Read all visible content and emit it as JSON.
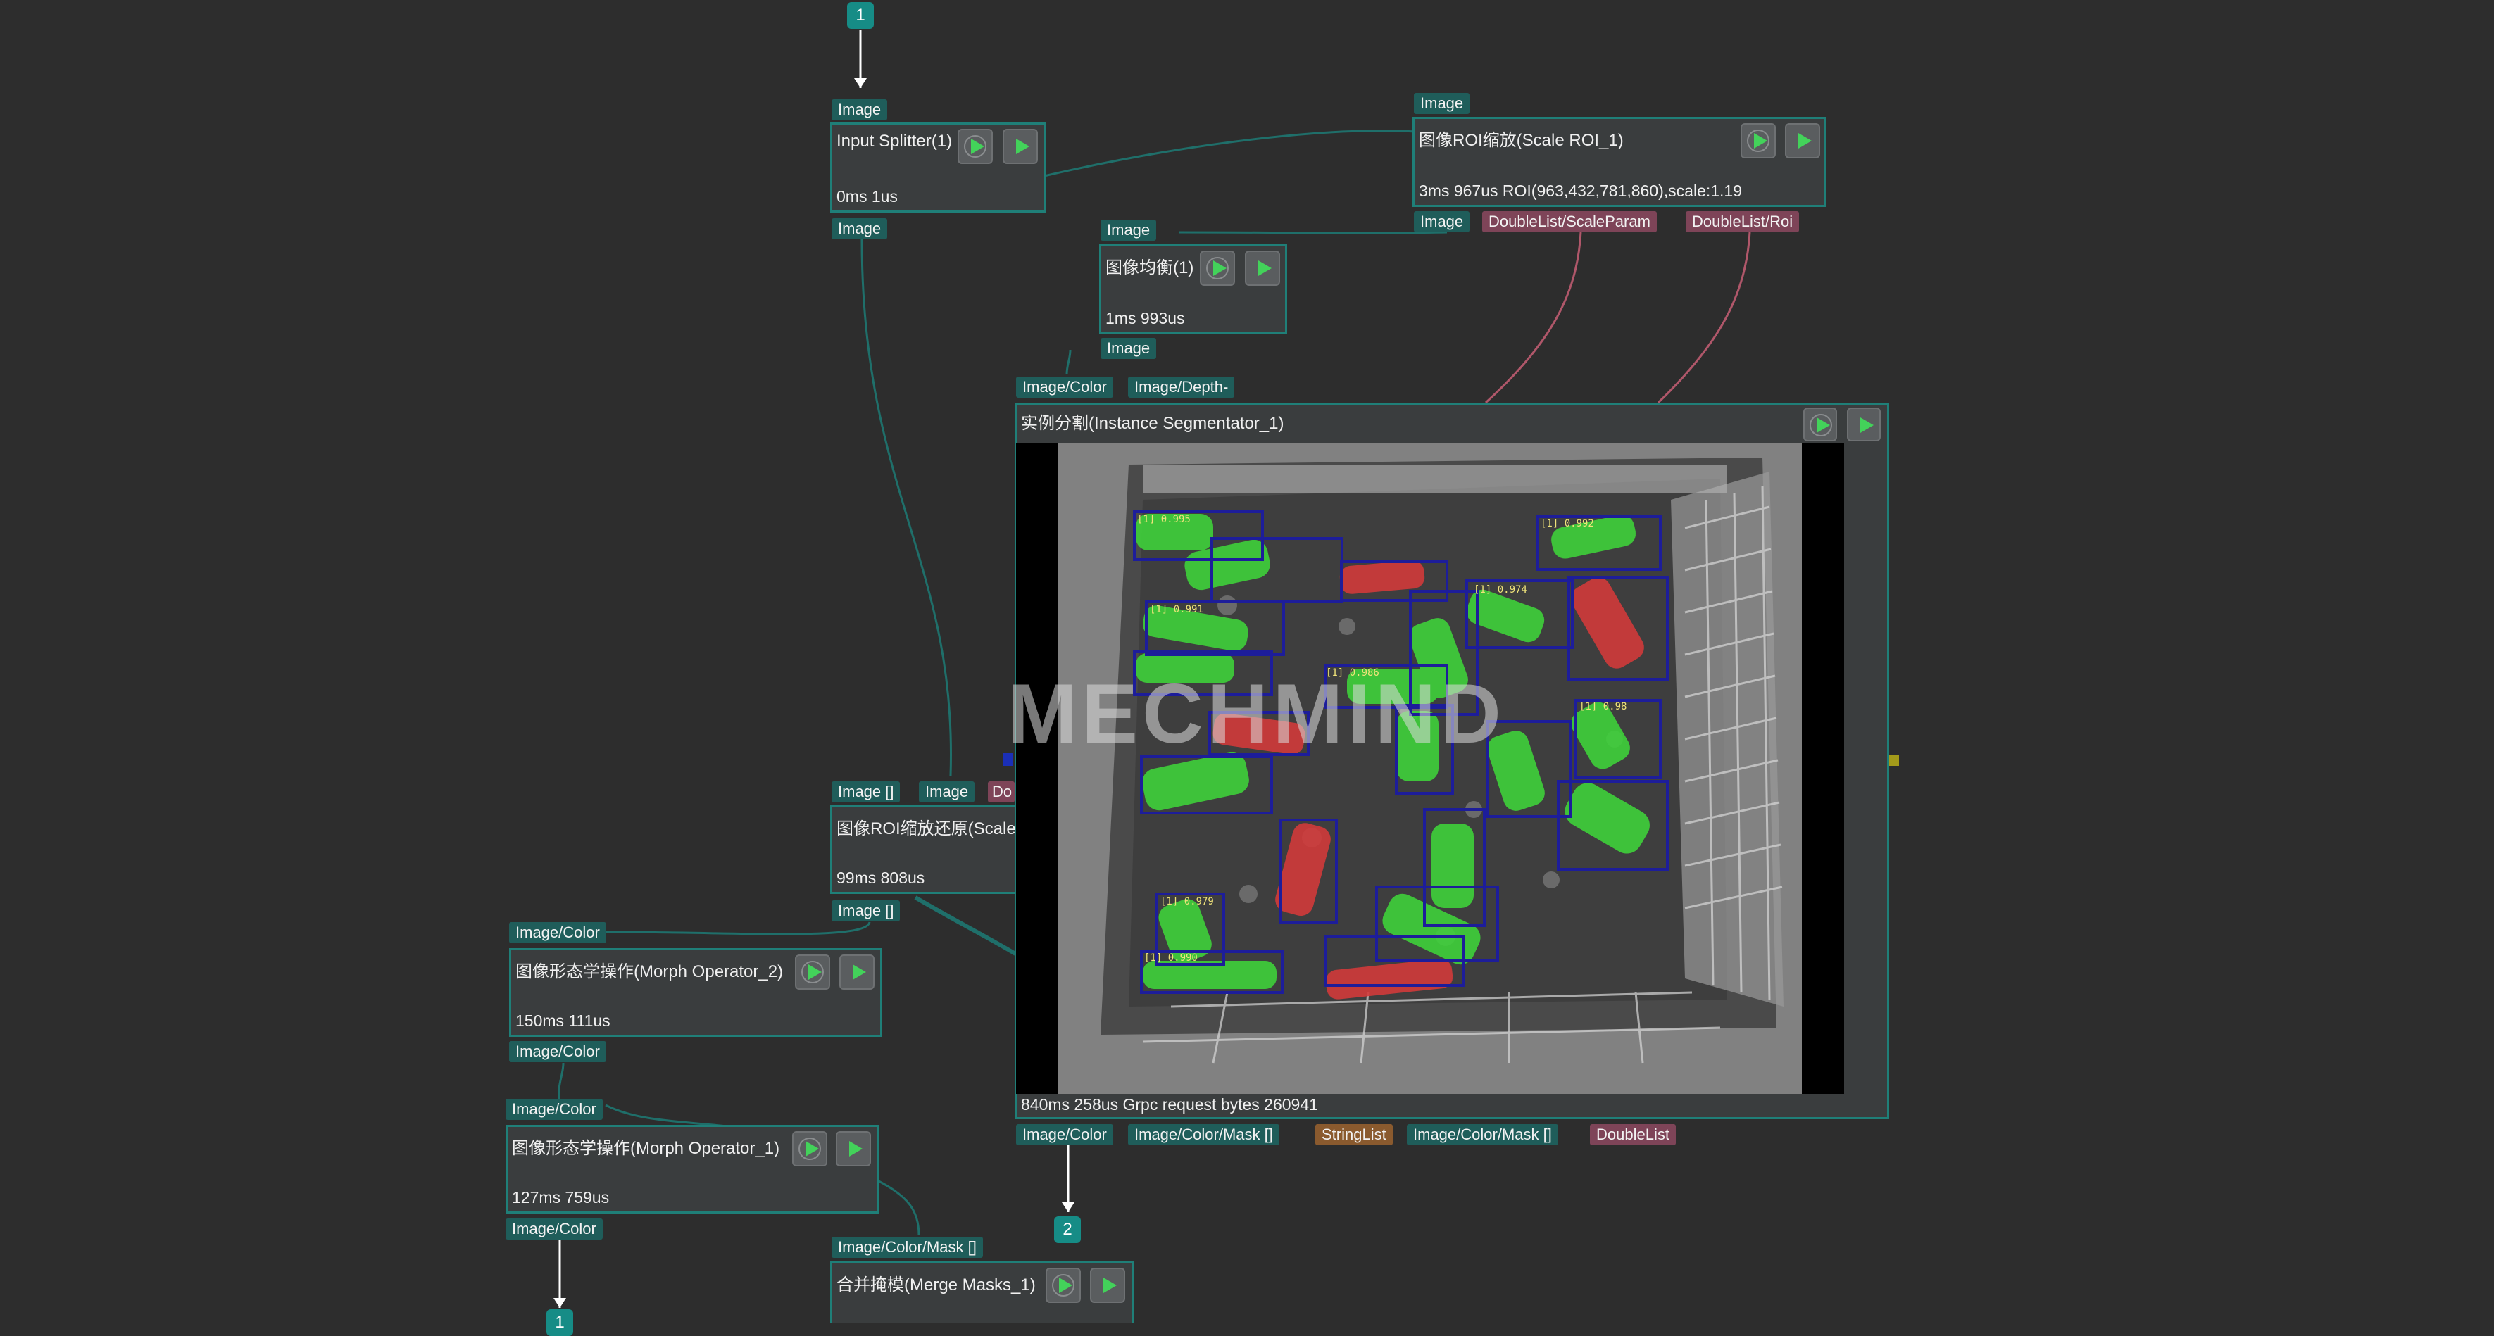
{
  "badges": {
    "top": "1",
    "seg_out": "2",
    "bottom": "1"
  },
  "input_splitter": {
    "port_in": "Image",
    "title": "Input Splitter(1)",
    "time": "0ms 1us",
    "port_out": "Image"
  },
  "scale_roi": {
    "port_in": "Image",
    "title": "图像ROI缩放(Scale ROI_1)",
    "time": "3ms 967us ROI(963,432,781,860),scale:1.19",
    "port_out_1": "Image",
    "port_out_2": "DoubleList/ScaleParam",
    "port_out_3": "DoubleList/Roi"
  },
  "balance": {
    "port_in": "Image",
    "title": "图像均衡(1)",
    "time": "1ms 993us",
    "port_out": "Image"
  },
  "segmentator": {
    "port_in_1": "Image/Color",
    "port_in_2": "Image/Depth-",
    "title": "实例分割(Instance Segmentator_1)",
    "time": "840ms 258us Grpc request bytes 260941",
    "port_out_1": "Image/Color",
    "port_out_2": "Image/Color/Mask []",
    "port_out_3": "StringList",
    "port_out_4": "Image/Color/Mask []",
    "port_out_5": "DoubleList",
    "watermark": "MECHMIND"
  },
  "scale_restore": {
    "port_in_1": "Image []",
    "port_in_2": "Image",
    "port_in_3": "Do",
    "title": "图像ROI缩放还原(Scale",
    "time": "99ms 808us",
    "port_out": "Image []"
  },
  "morph2": {
    "port_in": "Image/Color",
    "title": "图像形态学操作(Morph Operator_2)",
    "time": "150ms 111us",
    "port_out": "Image/Color"
  },
  "morph1": {
    "port_in": "Image/Color",
    "title": "图像形态学操作(Morph Operator_1)",
    "time": "127ms 759us",
    "port_out": "Image/Color"
  },
  "merge": {
    "port_in": "Image/Color/Mask []",
    "title": "合并掩模(Merge Masks_1)"
  },
  "colors": {
    "background": "#2d2d2d",
    "node_border": "#1f7f78",
    "port": "#1f5d5a",
    "port_pink": "#7e4458",
    "port_brown": "#8a5a2e",
    "play": "#43d25a",
    "mask_green": "#3fd23a",
    "mask_red": "#d23a3a",
    "box_blue": "#1d1d9a"
  }
}
